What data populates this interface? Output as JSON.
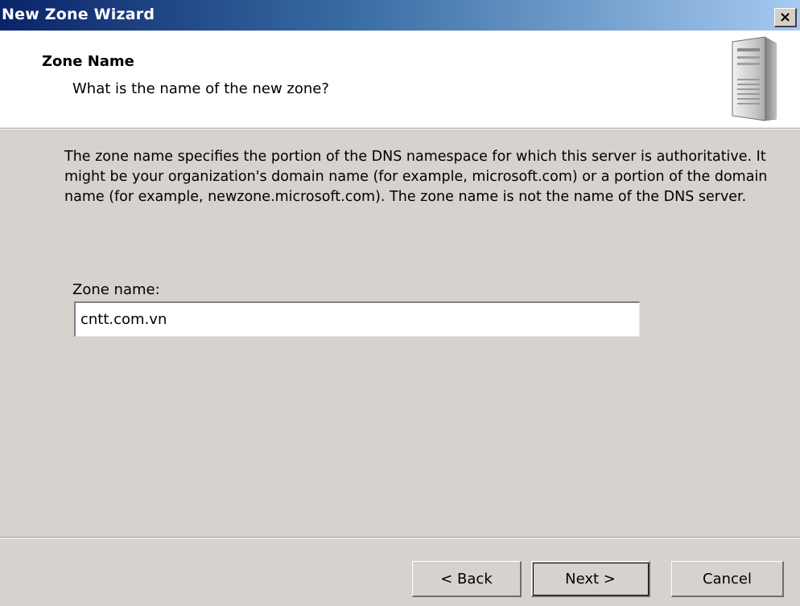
{
  "window": {
    "title": "New Zone Wizard",
    "close_label": "×"
  },
  "header": {
    "title": "Zone Name",
    "subtitle": "What is the name of the new zone?",
    "icon": "server-icon"
  },
  "main": {
    "description": "The zone name specifies the portion of the DNS namespace for which this server is authoritative. It might be your organization's domain name (for example,  microsoft.com) or a portion of the domain name (for example, newzone.microsoft.com). The zone name is not the name of the DNS server.",
    "zone_name_label": "Zone name:",
    "zone_name_value": "cntt.com.vn"
  },
  "footer": {
    "back_label": "< Back",
    "next_label": "Next >",
    "cancel_label": "Cancel"
  },
  "colors": {
    "title_bar_start": "#0a246a",
    "title_bar_end": "#a6caf0",
    "dialog_face": "#d6d3ce",
    "header_bg": "#ffffff"
  }
}
